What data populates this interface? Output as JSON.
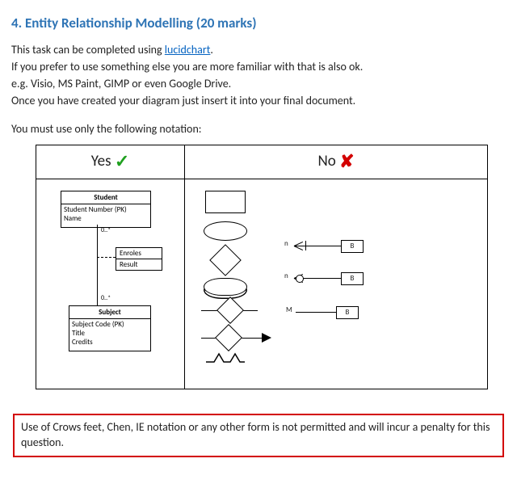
{
  "heading": "4.  Entity Relationship Modelling (20 marks)",
  "intro": {
    "line1_a": "This task can be completed using ",
    "link_text": "lucidchart",
    "line1_b": ".",
    "line2": "If you prefer to use something else you are more familiar with that is also ok.",
    "line3": "e.g. Visio, MS Paint, GIMP or even Google Drive.",
    "line4": "Once you have created your diagram just insert it into your final document.",
    "line5": "You must use only the following notation:"
  },
  "table": {
    "yes_label": "Yes",
    "no_label": "No"
  },
  "uml": {
    "class1": {
      "name": "Student",
      "attrs": [
        "Student Number (PK)",
        "Name"
      ]
    },
    "assoc": {
      "top": "Enroles",
      "bottom": "Result"
    },
    "class2": {
      "name": "Subject",
      "attrs": [
        "Subject Code (PK)",
        "Title",
        "Credits"
      ]
    },
    "mult_top": "0..*",
    "mult_bottom": "0..*"
  },
  "no_shapes": {
    "box_label": "B",
    "card_m": "M",
    "card_n1": "n",
    "card_n2": "n"
  },
  "warning": "Use of Crows feet, Chen, IE notation or any other form is not permitted and will incur a penalty for this question."
}
